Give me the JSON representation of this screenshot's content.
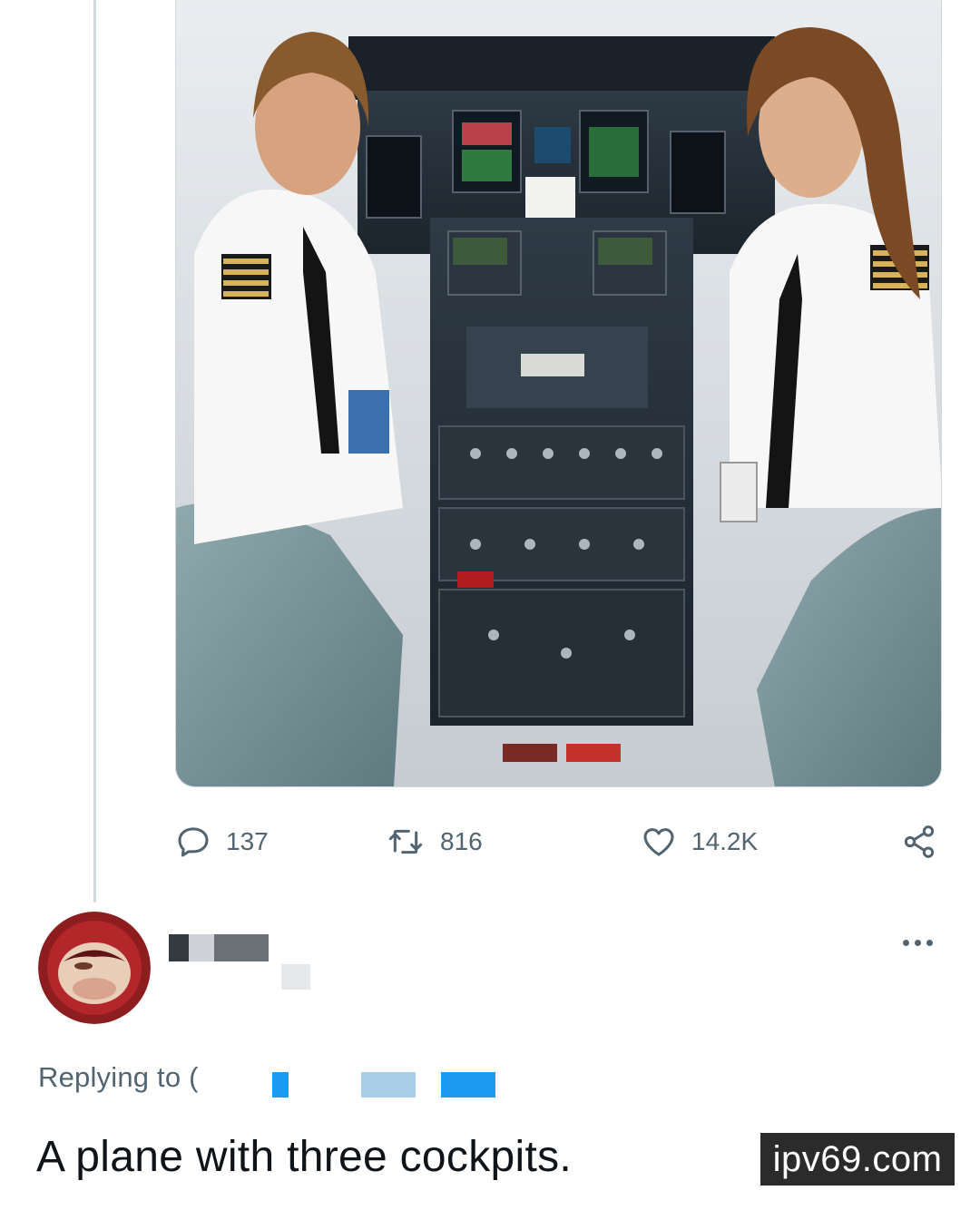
{
  "tweet": {
    "photo_alt": "Two pilots in a cockpit",
    "actions": {
      "replies": "137",
      "retweets": "816",
      "likes": "14.2K"
    },
    "icons": {
      "reply": "reply-bubble-icon",
      "retweet": "retweet-icon",
      "like": "heart-icon",
      "share": "share-icon"
    }
  },
  "reply": {
    "author_name": "",
    "author_handle": "",
    "replying_to_label": "Replying to (",
    "text": "A plane with three cockpits."
  },
  "watermark": "ipv69.com",
  "colors": {
    "secondary_text": "#536471",
    "primary_text": "#0f1419",
    "thread_line": "#cfd9de",
    "redaction_blue": "#1d9bf0"
  }
}
